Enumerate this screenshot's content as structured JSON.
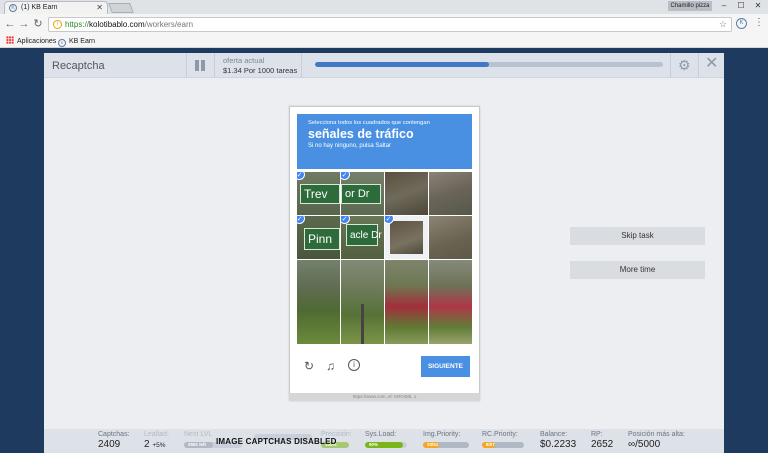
{
  "browser": {
    "tab_title": "(1) KB Earn",
    "user_name": "Chamillo pizza",
    "url_scheme": "https://",
    "url_host": "kolotibablo.com",
    "url_path": "/workers/earn",
    "bookmarks": [
      "Aplicaciones",
      "KB Earn"
    ]
  },
  "task_bar": {
    "task_name": "Recaptcha",
    "offer_label": "oferta actual",
    "offer_value": "$1.34 Por 1000 tareas",
    "progress_fraction": 0.5
  },
  "captcha": {
    "instruction": "Selecciona todos los cuadrados que contengan",
    "target": "señales de tráfico",
    "subtext": "Si no hay ninguno, pulsa Saltar",
    "tiles": [
      {
        "row": 0,
        "col": 0,
        "content": "Trev",
        "selected": true
      },
      {
        "row": 0,
        "col": 1,
        "content": "or Dr",
        "selected": true
      },
      {
        "row": 0,
        "col": 2,
        "content": "",
        "selected": false
      },
      {
        "row": 0,
        "col": 3,
        "content": "",
        "selected": false
      },
      {
        "row": 1,
        "col": 0,
        "content": "Pinn",
        "selected": true
      },
      {
        "row": 1,
        "col": 1,
        "content": "acle Dr",
        "selected": true
      },
      {
        "row": 1,
        "col": 2,
        "content": "",
        "selected": true
      },
      {
        "row": 1,
        "col": 3,
        "content": "",
        "selected": false
      }
    ],
    "next_button": "SIGUIENTE",
    "icons": [
      "reload-icon",
      "audio-icon",
      "info-icon"
    ],
    "url_footer": "https://www.com, el: KRO485, 1"
  },
  "side_buttons": {
    "skip": "Skip task",
    "more_time": "More time"
  },
  "stats": {
    "captchas": {
      "label": "Captchas:",
      "value": "2409"
    },
    "loyalty": {
      "label": "Lealtad:",
      "value": "2",
      "delta": "+5%"
    },
    "next_lvl": {
      "label": "Next LVL",
      "bar_text": "2591 left",
      "fraction": 0.5
    },
    "accuracy": {
      "label": "Precisión:",
      "bar_text": "100%",
      "fraction": 1.0
    },
    "sys_load": {
      "label": "Sys.Load:",
      "bar_text": "90%",
      "fraction": 0.9
    },
    "img_priority": {
      "label": "Img.Priority:",
      "bar_text": "33/51",
      "fraction": 0.35
    },
    "rc_priority": {
      "label": "RC.Priority:",
      "bar_text": "8/57",
      "fraction": 0.3
    },
    "balance": {
      "label": "Balance:",
      "value": "$0.2233"
    },
    "rp": {
      "label": "RP:",
      "value": "2652"
    },
    "max_position": {
      "label": "Posición más alta:",
      "value": "∞/5000"
    },
    "overlay_message": "IMAGE CAPTCHAS DISABLED"
  },
  "colors": {
    "accent": "#4a90e2",
    "progress": "#3e7bc4",
    "bar_green": "#7cb518",
    "bar_orange": "#f5a623",
    "bar_gray": "#b0b8c4"
  }
}
